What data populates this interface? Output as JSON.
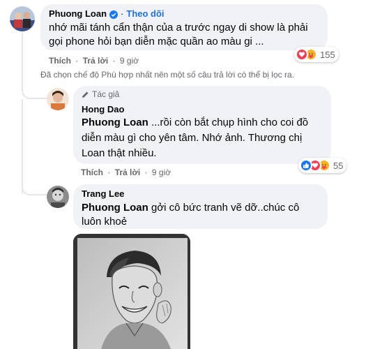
{
  "comment1": {
    "author": "Phuong Loan",
    "follow_label": "Theo dõi",
    "text": "nhớ mãi tánh cẩn thận của a trước ngay di show là phải gọi phone hỏi bạn diễn mặc quần ao màu gi ...",
    "like_label": "Thích",
    "reply_label": "Trả lời",
    "time": "9 giờ",
    "reaction_count": "155"
  },
  "filter_notice": "Đã chọn chế độ Phù hợp nhất nên một số câu trả lời có thể bị lọc ra.",
  "reply1": {
    "badge": "Tác giả",
    "author": "Hong Dao",
    "tag": "Phuong Loan",
    "text": " ...rồi còn bắt chụp hình cho coi đồ diễn màu gì cho yên tâm. Nhớ ảnh. Thương chị Loan thật nhiều.",
    "like_label": "Thích",
    "reply_label": "Trả lời",
    "time": "9 giờ",
    "reaction_count": "55"
  },
  "reply2": {
    "author": "Trang Lee",
    "tag": "Phuong Loan",
    "text": " gởi cô bức tranh vẽ dỡ..chúc cô luôn khoẻ"
  },
  "colors": {
    "link_blue": "#216fdb",
    "verified_blue": "#1877f2",
    "bubble_bg": "#f0f2f5",
    "meta_gray": "#65676b"
  },
  "icons": [
    "verified-icon",
    "pencil-icon",
    "like-reaction-icon",
    "love-reaction-icon",
    "care-reaction-icon"
  ]
}
